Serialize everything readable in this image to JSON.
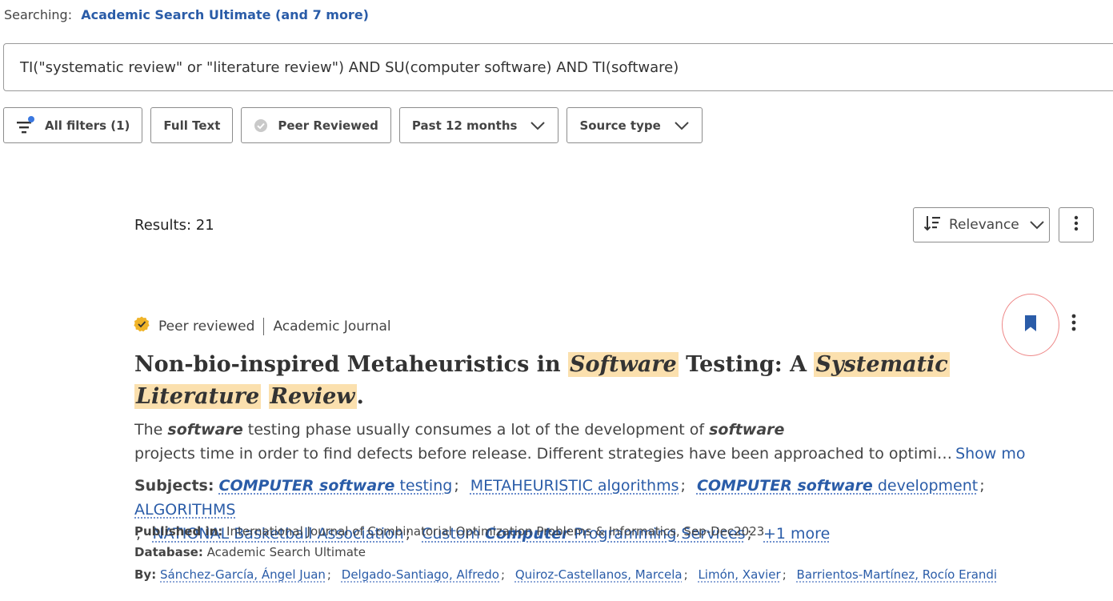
{
  "searching": {
    "label": "Searching:",
    "databases_link": "Academic Search Ultimate (and 7 more)"
  },
  "search": {
    "query": "TI(\"systematic review\" or \"literature review\") AND SU(computer software) AND TI(software)"
  },
  "filters": {
    "all_filters": "All filters (1)",
    "full_text": "Full Text",
    "peer_reviewed": "Peer Reviewed",
    "date": "Past 12 months",
    "source_type": "Source type"
  },
  "results": {
    "count_label": "Results: 21",
    "sort_label": "Relevance"
  },
  "item": {
    "peer_reviewed": "Peer reviewed",
    "source_type": "Academic Journal",
    "title_parts": {
      "t1": "Non-bio-inspired Metaheuristics in ",
      "h1": "Software",
      "t2": " Testing: A ",
      "h2": "Systematic",
      "h3": "Literature",
      "h4": "Review",
      "t3": "."
    },
    "abstract": {
      "a1": "The ",
      "b1": "software",
      "a2": " testing phase usually consumes a lot of the development of ",
      "b2": "software",
      "a3": "projects time in order to find defects before release. Different strategies have been approached to optimi…",
      "show_more": "Show more"
    },
    "subjects_label": "Subjects:",
    "subjects": {
      "s1_b": "COMPUTER software",
      "s1_t": " testing",
      "s2": "METAHEURISTIC algorithms",
      "s3_b": "COMPUTER software",
      "s3_t": " development",
      "s4": "ALGORITHMS",
      "s5": "NATIONAL Basketball Association",
      "s6_a": "Custom ",
      "s6_b": "Computer",
      "s6_c": " Programming Services",
      "more": "+1 more",
      "sep": ";"
    },
    "published_label": "Published in:",
    "published": "International Journal of Combinatorial Optimization Problems & Informatics, Sep-Dec2023",
    "database_label": "Database:",
    "database": "Academic Search Ultimate",
    "by_label": "By:",
    "authors": [
      "Sánchez-García, Ángel Juan",
      "Delgado-Santiago, Alfredo",
      "Quiroz-Castellanos, Marcela",
      "Limón, Xavier",
      "Barrientos-Martínez, Rocío Erandi"
    ]
  },
  "colors": {
    "link": "#2a5ca8",
    "highlight": "#fbe0ae",
    "badge": "#f0b429",
    "filter_dot": "#3b78e0"
  },
  "icons": {
    "filter": "filter-icon",
    "peer_check": "check-badge-icon",
    "chevron": "chevron-down-icon",
    "sort": "sort-icon",
    "more": "more-vertical-icon",
    "bookmark": "bookmark-icon"
  }
}
